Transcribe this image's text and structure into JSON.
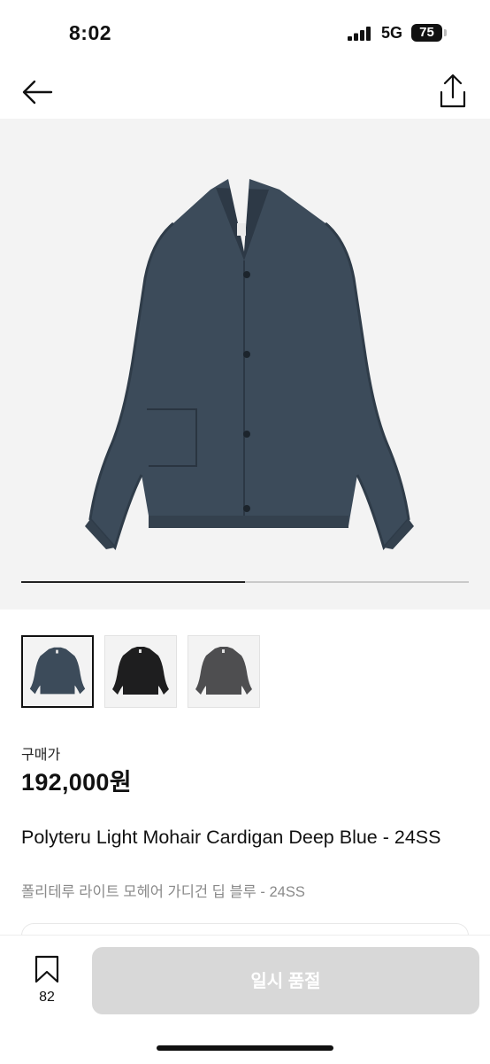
{
  "status": {
    "time": "8:02",
    "network": "5G",
    "battery": "75"
  },
  "nav": {
    "back_icon": "arrow-left-icon",
    "share_icon": "share-icon"
  },
  "gallery": {
    "current_index": 1,
    "image_count": 2,
    "progress_fraction": 0.5,
    "thumbnails": [
      {
        "color": "#3c4b5a",
        "selected": true
      },
      {
        "color": "#1e1e1f",
        "selected": false
      },
      {
        "color": "#4e4e50",
        "selected": false
      }
    ]
  },
  "product": {
    "price_label": "구매가",
    "price": "192,000원",
    "title": "Polyteru Light Mohair Cardigan Deep Blue - 24SS",
    "subtitle": "폴리테루 라이트 모헤어 가디건 딥 블루 - 24SS"
  },
  "bottom": {
    "bookmark_count": "82",
    "cta_label": "일시 품절"
  },
  "colors": {
    "cardigan": "#3c4b5a",
    "cta_disabled": "#d8d8d8",
    "accent": "#111111"
  }
}
